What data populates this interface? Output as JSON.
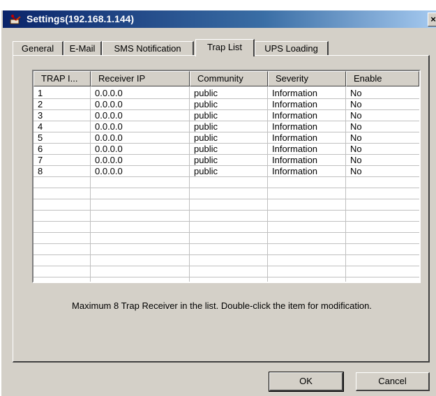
{
  "window": {
    "title": "Settings(192.168.1.144)",
    "close_label": "×"
  },
  "tabs": [
    "General",
    "E-Mail",
    "SMS Notification",
    "Trap List",
    "UPS Loading"
  ],
  "active_tab": "Trap List",
  "list": {
    "columns": [
      "TRAP I...",
      "Receiver IP",
      "Community",
      "Severity",
      "Enable"
    ],
    "rows": [
      [
        "1",
        "0.0.0.0",
        "public",
        "Information",
        "No"
      ],
      [
        "2",
        "0.0.0.0",
        "public",
        "Information",
        "No"
      ],
      [
        "3",
        "0.0.0.0",
        "public",
        "Information",
        "No"
      ],
      [
        "4",
        "0.0.0.0",
        "public",
        "Information",
        "No"
      ],
      [
        "5",
        "0.0.0.0",
        "public",
        "Information",
        "No"
      ],
      [
        "6",
        "0.0.0.0",
        "public",
        "Information",
        "No"
      ],
      [
        "7",
        "0.0.0.0",
        "public",
        "Information",
        "No"
      ],
      [
        "8",
        "0.0.0.0",
        "public",
        "Information",
        "No"
      ]
    ]
  },
  "note": "Maximum 8 Trap Receiver in the list. Double-click the item for modification.",
  "buttons": {
    "ok": "OK",
    "cancel": "Cancel"
  },
  "icons": {
    "app": "ups-app-icon",
    "close": "close-icon"
  }
}
